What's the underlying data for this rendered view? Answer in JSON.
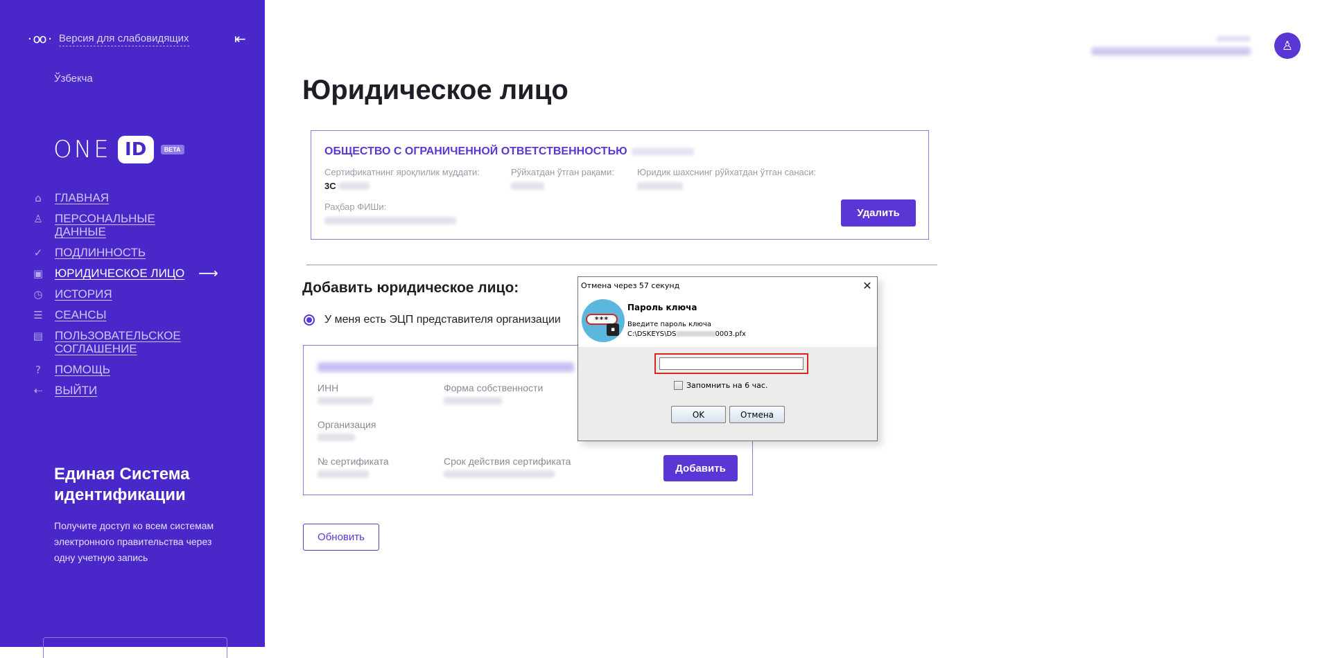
{
  "sidebar": {
    "accessibility_label": "Версия для слабовидящих",
    "language": "Ўзбекча",
    "logo": {
      "one": "ONE",
      "id": "ID",
      "beta": "BETA"
    },
    "nav": [
      {
        "label": "Главная",
        "icon": "home-icon",
        "active": false
      },
      {
        "label": "Персональные данные",
        "icon": "user-icon",
        "active": false
      },
      {
        "label": "Подлинность",
        "icon": "check-circle-icon",
        "active": false
      },
      {
        "label": "Юридическое лицо",
        "icon": "briefcase-icon",
        "active": true
      },
      {
        "label": "История",
        "icon": "clock-icon",
        "active": false
      },
      {
        "label": "Сеансы",
        "icon": "list-icon",
        "active": false
      },
      {
        "label": "Пользовательское соглашение",
        "icon": "document-icon",
        "active": false
      },
      {
        "label": "Помощь",
        "icon": "question-icon",
        "active": false
      },
      {
        "label": "Выйти",
        "icon": "logout-icon",
        "active": false
      }
    ],
    "promo_title": "Единая Система идентификации",
    "promo_text": "Получите доступ ко всем системам электронного правительства через одну учетную запись"
  },
  "main": {
    "title": "Юридическое лицо",
    "entity": {
      "name": "ОБЩЕСТВО С ОГРАНИЧЕННОЙ ОТВЕТСТВЕННОСТЬЮ",
      "cert_validity_label": "Сертификатнинг ярок̧лилик муддати:",
      "cert_validity_value": "3C",
      "reg_number_label": "Рўйхатдан ўтган рақами:",
      "reg_date_label": "Юридик шахснинг рўйхатдан ўтган санаси:",
      "director_label": "Раҳбар ФИШи:",
      "delete_button": "Удалить"
    },
    "add_title": "Добавить юридическое лицо:",
    "radio_label": "У меня есть ЭЦП представителя организации",
    "cert": {
      "inn_label": "ИНН",
      "ownership_label": "Форма собственности",
      "org_label": "Организация",
      "cert_no_label": "№ сертификата",
      "validity_label": "Срок действия сертификата",
      "add_button": "Добавить"
    },
    "refresh_button": "Обновить"
  },
  "dialog": {
    "title": "Отмена через 57 секунд",
    "header_title": "Пароль ключа",
    "header_subtitle": "Введите пароль ключа",
    "path_prefix": "C:\\DSKEYS\\DS",
    "path_suffix": "0003.pfx",
    "key_stars": "***",
    "remember_label": "Запомнить на 6 час.",
    "ok_button": "OK",
    "cancel_button": "Отмена"
  },
  "colors": {
    "sidebar": "#4a27c9",
    "accent": "#5a37d4",
    "dialog_highlight": "#dd2222"
  }
}
